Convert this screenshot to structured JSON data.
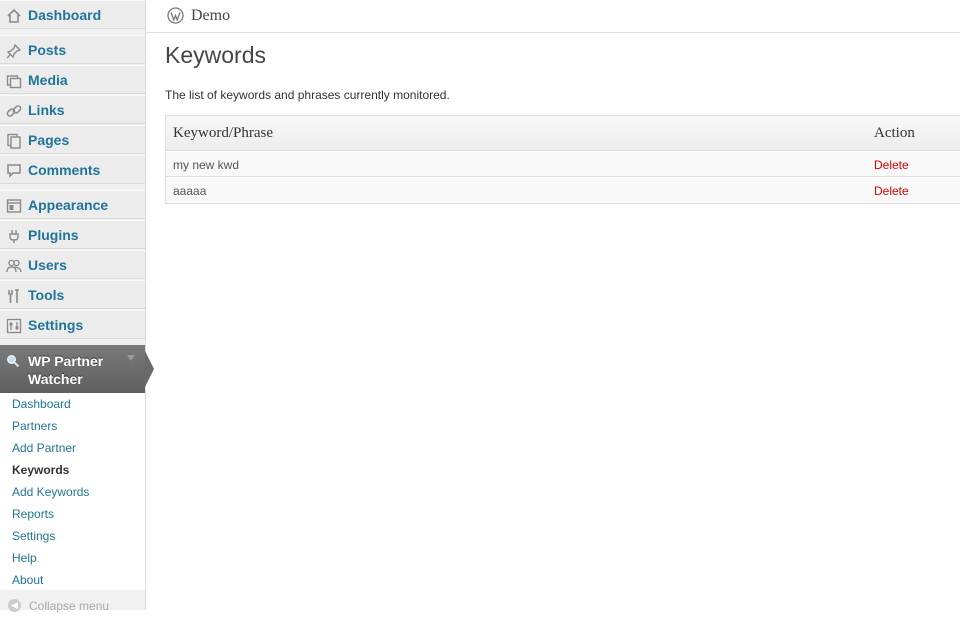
{
  "sidebar": {
    "items": [
      {
        "label": "Dashboard",
        "icon": "dashboard-icon"
      },
      {
        "label": "Posts",
        "icon": "pin-icon"
      },
      {
        "label": "Media",
        "icon": "media-icon"
      },
      {
        "label": "Links",
        "icon": "link-icon"
      },
      {
        "label": "Pages",
        "icon": "pages-icon"
      },
      {
        "label": "Comments",
        "icon": "comment-icon"
      },
      {
        "label": "Appearance",
        "icon": "appearance-icon"
      },
      {
        "label": "Plugins",
        "icon": "plugin-icon"
      },
      {
        "label": "Users",
        "icon": "users-icon"
      },
      {
        "label": "Tools",
        "icon": "tools-icon"
      },
      {
        "label": "Settings",
        "icon": "settings-icon"
      }
    ],
    "active": {
      "label": "WP Partner Watcher",
      "icon": "search-icon"
    },
    "submenu": [
      "Dashboard",
      "Partners",
      "Add Partner",
      "Keywords",
      "Add Keywords",
      "Reports",
      "Settings",
      "Help",
      "About"
    ],
    "current_sub": "Keywords",
    "collapse_label": "Collapse menu"
  },
  "header": {
    "site_name": "Demo"
  },
  "page": {
    "title": "Keywords",
    "description": "The list of keywords and phrases currently monitored."
  },
  "table": {
    "columns": [
      "Keyword/Phrase",
      "Action"
    ],
    "rows": [
      {
        "keyword": "my new kwd",
        "action": "Delete"
      },
      {
        "keyword": "aaaaa",
        "action": "Delete"
      }
    ]
  },
  "colors": {
    "link": "#21759b",
    "delete": "#dd0000",
    "active_menu": "#6a6a6a"
  }
}
